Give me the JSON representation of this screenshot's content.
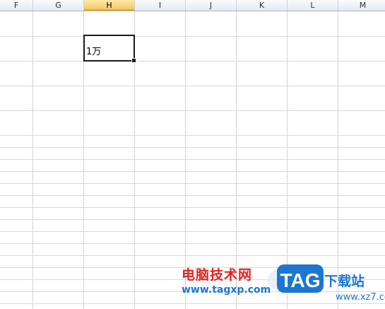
{
  "sheet": {
    "columns": [
      "F",
      "G",
      "H",
      "I",
      "J",
      "K",
      "L",
      "M"
    ],
    "selected_column": "H",
    "active_cell": {
      "ref": "H3",
      "value": "1万"
    }
  },
  "watermark": {
    "site_name": "电脑技术网",
    "site_url": "www.tagxp.com",
    "logo_text": "TAG",
    "right_name": "下载站",
    "right_url": "www.xz7.com"
  },
  "colors": {
    "header_selected": "#f7c862",
    "gridline": "#d4d4d4",
    "watermark_red": "#e8211d",
    "watermark_blue": "#1c76d2"
  }
}
